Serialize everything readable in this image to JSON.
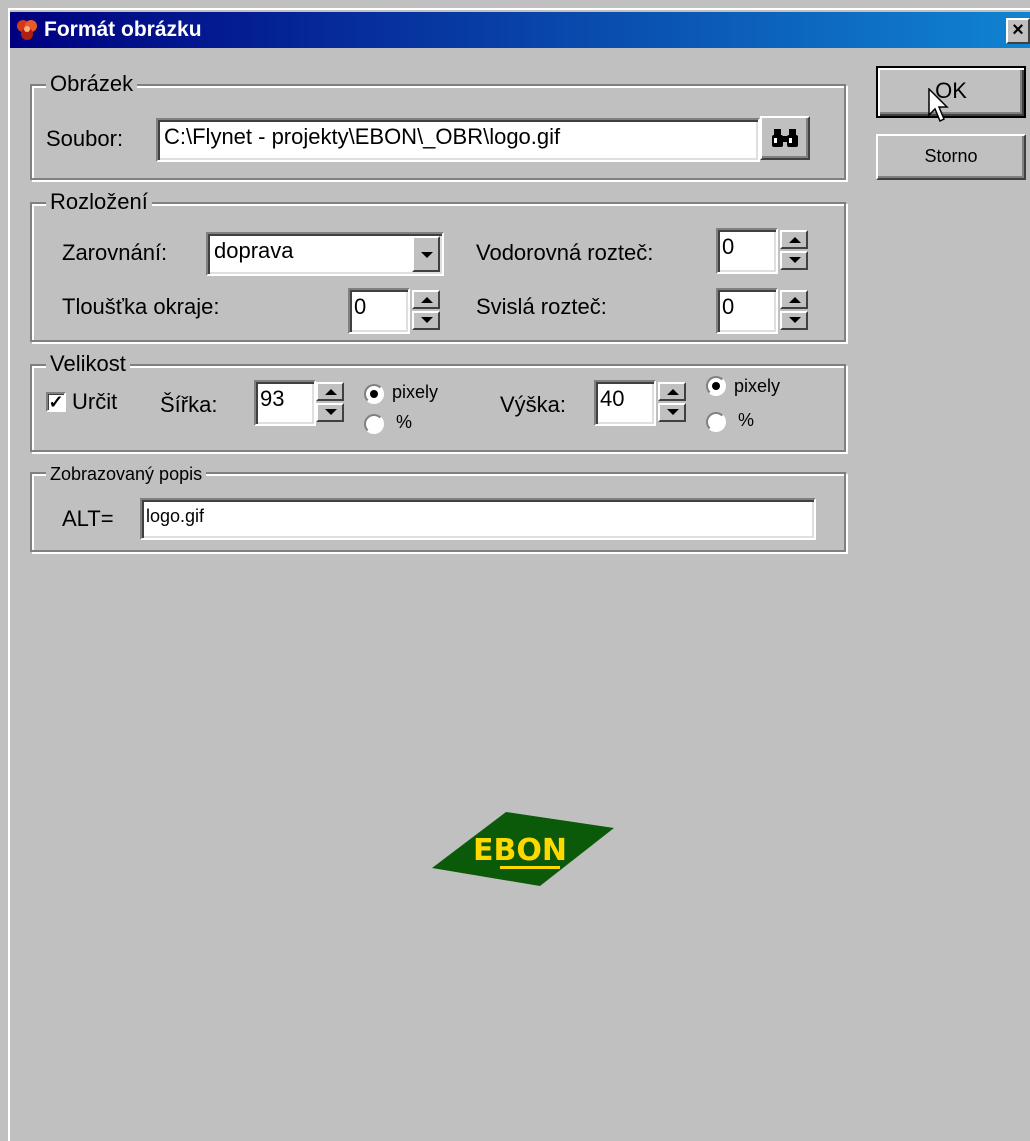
{
  "window": {
    "title": "Formát obrázku",
    "close_label": "×"
  },
  "buttons": {
    "ok": "OK",
    "cancel": "Storno"
  },
  "obrazek": {
    "group_title": "Obrázek",
    "file_label": "Soubor:",
    "file_value": "C:\\Flynet - projekty\\EBON\\_OBR\\logo.gif",
    "browse_icon": "binoculars-icon"
  },
  "rozlozeni": {
    "group_title": "Rozložení",
    "align_label": "Zarovnání:",
    "align_value": "doprava",
    "border_label": "Tloušťka okraje:",
    "border_value": "0",
    "hspace_label": "Vodorovná rozteč:",
    "hspace_value": "0",
    "vspace_label": "Svislá rozteč:",
    "vspace_value": "0"
  },
  "velikost": {
    "group_title": "Velikost",
    "determine_label": "Určit",
    "determine_checked": true,
    "width_label": "Šířka:",
    "width_value": "93",
    "height_label": "Výška:",
    "height_value": "40",
    "unit_pixels": "pixely",
    "unit_percent": "%",
    "width_unit_selected": "pixely",
    "height_unit_selected": "pixely"
  },
  "popis": {
    "group_title": "Zobrazovaný popis",
    "alt_label": "ALT=",
    "alt_value": "logo.gif"
  },
  "preview": {
    "logo_text": "EBON",
    "logo_colors": {
      "diamond": "#0a5a0a",
      "text": "#ffd800"
    }
  },
  "colors": {
    "titlebar_start": "#000080",
    "titlebar_end": "#1084d0",
    "face": "#c0c0c0"
  }
}
